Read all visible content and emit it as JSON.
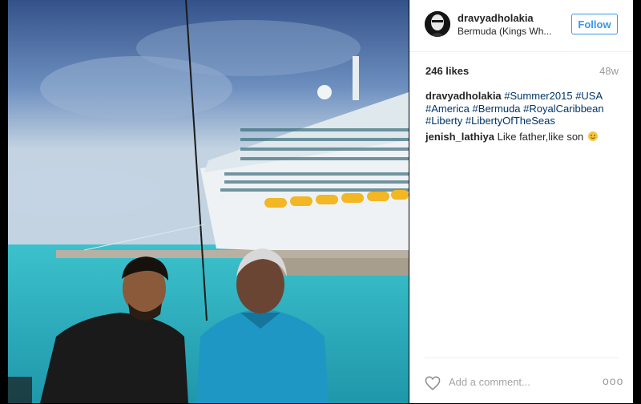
{
  "post": {
    "image_alt": "Two men in front of Liberty of the Seas cruise ship"
  },
  "header": {
    "username": "dravyadholakia",
    "location": "Bermuda (Kings Wh...",
    "follow_label": "Follow"
  },
  "stats": {
    "likes": "246 likes",
    "time_ago": "48w"
  },
  "caption": {
    "username": "dravyadholakia",
    "hashtags": [
      "#Summer2015",
      "#USA",
      "#America",
      "#Bermuda",
      "#RoyalCaribbean",
      "#Liberty",
      "#LibertyOfTheSeas"
    ]
  },
  "comments": [
    {
      "username": "jenish_lathiya",
      "text": "Like father,like son",
      "emoji": "smile-emoji"
    }
  ],
  "footer": {
    "comment_placeholder": "Add a comment...",
    "more_label": "ooo"
  },
  "colors": {
    "link": "#003569",
    "follow_blue": "#3897f0",
    "muted": "#999999"
  }
}
